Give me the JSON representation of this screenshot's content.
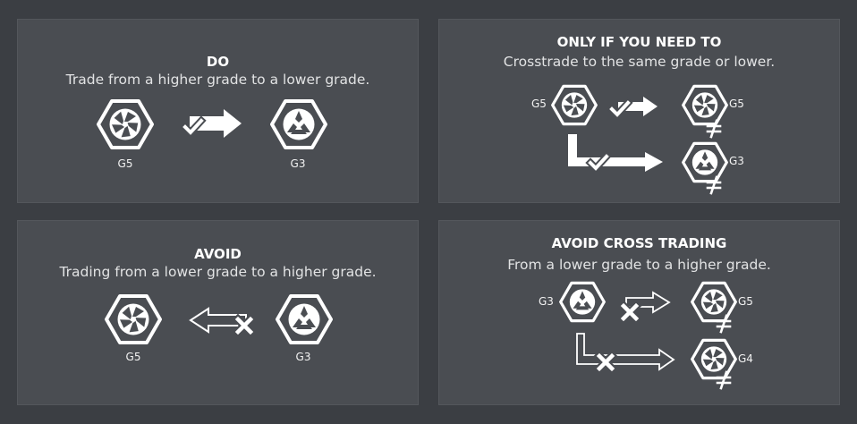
{
  "panels": {
    "do": {
      "title": "DO",
      "subtitle": "Trade from a higher grade to a lower grade.",
      "from": "G5",
      "to": "G3"
    },
    "only": {
      "title": "ONLY IF YOU NEED TO",
      "subtitle": "Crosstrade to the same grade or lower.",
      "source": "G5",
      "target_a": "G5",
      "target_b": "G3"
    },
    "avoid": {
      "title": "AVOID",
      "subtitle": "Trading from a lower grade to a higher grade.",
      "left": "G5",
      "right": "G3"
    },
    "avoid_cross": {
      "title": "AVOID CROSS TRADING",
      "subtitle": "From a lower grade to a higher grade.",
      "source": "G3",
      "target_a": "G5",
      "target_b": "G4"
    }
  },
  "icons": {
    "grade5": "g5-pinwheel-hexagon-icon",
    "grade3": "g3-triangle-hexagon-icon",
    "ok": "checkmark-icon",
    "no": "cross-icon",
    "neq": "not-equal-icon"
  },
  "colors": {
    "background": "#3b3e43",
    "panel": "#4a4d52",
    "foreground": "#ffffff"
  }
}
